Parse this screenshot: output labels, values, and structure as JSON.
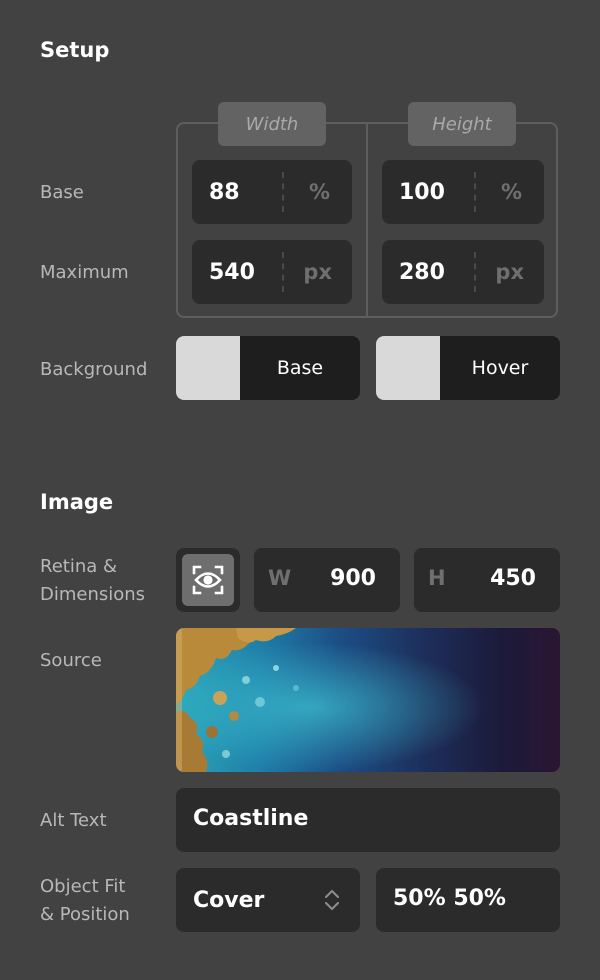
{
  "setup": {
    "title": "Setup",
    "columns": {
      "width": "Width",
      "height": "Height"
    },
    "base": {
      "label": "Base",
      "width_value": "88",
      "width_unit": "%",
      "height_value": "100",
      "height_unit": "%"
    },
    "maximum": {
      "label": "Maximum",
      "width_value": "540",
      "width_unit": "px",
      "height_value": "280",
      "height_unit": "px"
    },
    "background": {
      "label": "Background",
      "base_label": "Base",
      "hover_label": "Hover",
      "base_color": "#d9d9d9",
      "hover_color": "#d9d9d9"
    }
  },
  "image": {
    "title": "Image",
    "retina": {
      "label_line1": "Retina &",
      "label_line2": "Dimensions",
      "toggle_icon": "retina-preview-icon",
      "w_prefix": "W",
      "w_value": "900",
      "h_prefix": "H",
      "h_value": "450"
    },
    "source": {
      "label": "Source"
    },
    "alt_text": {
      "label": "Alt Text",
      "value": "Coastline"
    },
    "object_fit": {
      "label_line1": "Object Fit",
      "label_line2": "& Position",
      "fit_value": "Cover",
      "position_value": "50% 50%"
    }
  }
}
